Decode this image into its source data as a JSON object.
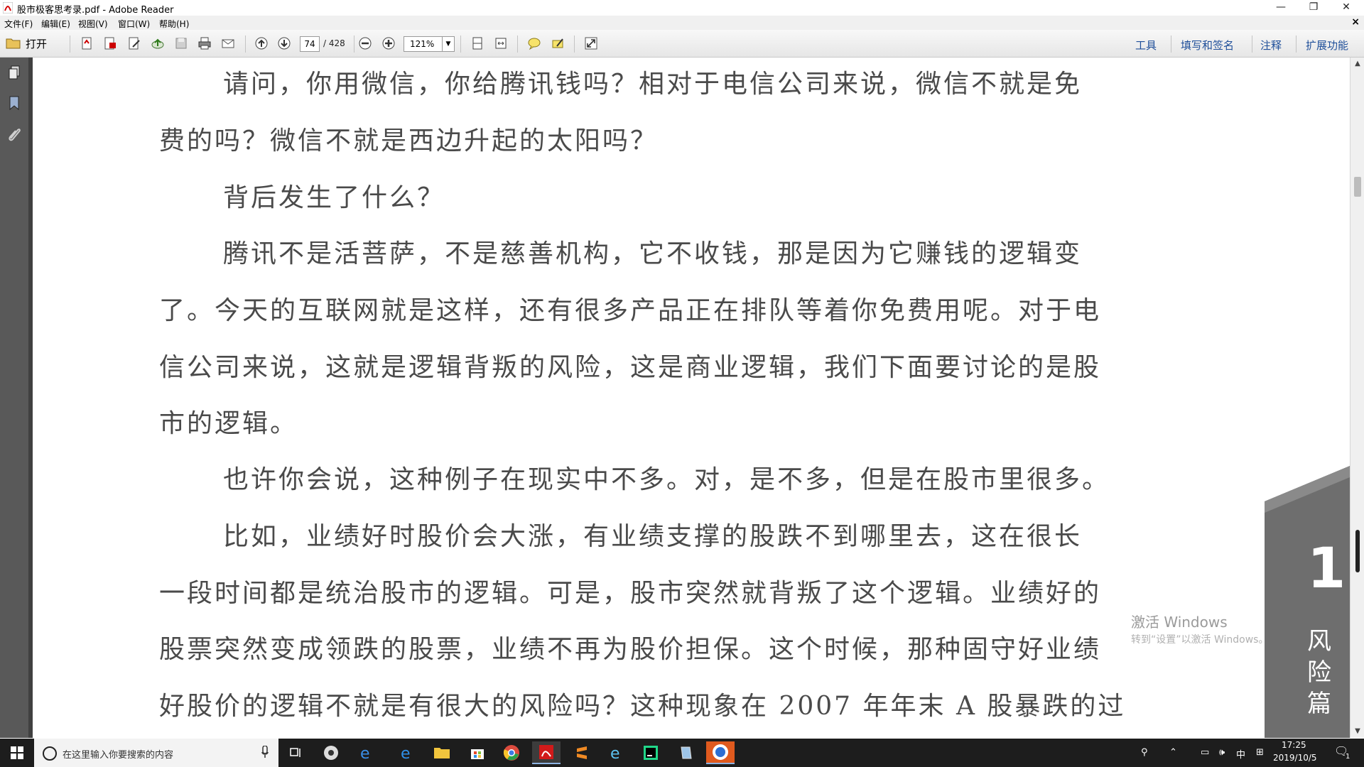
{
  "window": {
    "title": "股市极客思考录.pdf - Adobe Reader",
    "minimize": "—",
    "maximize": "❐",
    "close": "✕"
  },
  "menu": {
    "items": [
      "文件(F)",
      "编辑(E)",
      "视图(V)",
      "窗口(W)",
      "帮助(H)"
    ],
    "close_doc": "×"
  },
  "toolbar": {
    "open_label": "打开",
    "page_current": "74",
    "page_total": "/ 428",
    "zoom": "121%",
    "right_links": [
      "工具",
      "填写和签名",
      "注释",
      "扩展功能"
    ]
  },
  "document": {
    "lines": [
      "请问，你用微信，你给腾讯钱吗？相对于电信公司来说，微信不就是免",
      "费的吗？微信不就是西边升起的太阳吗？",
      "背后发生了什么？",
      "腾讯不是活菩萨，不是慈善机构，它不收钱，那是因为它赚钱的逻辑变",
      "了。今天的互联网就是这样，还有很多产品正在排队等着你免费用呢。对于电",
      "信公司来说，这就是逻辑背叛的风险，这是商业逻辑，我们下面要讨论的是股",
      "市的逻辑。",
      "也许你会说，这种例子在现实中不多。对，是不多，但是在股市里很多。",
      "比如，业绩好时股价会大涨，有业绩支撑的股跌不到哪里去，这在很长",
      "一段时间都是统治股市的逻辑。可是，股市突然就背叛了这个逻辑。业绩好的",
      "股票突然变成领跌的股票，业绩不再为股价担保。这个时候，那种固守好业绩",
      "好股价的逻辑不就是有很大的风险吗？这种现象在 2007 年年末 A 股暴跌的过"
    ],
    "side_tab_number": "1",
    "side_tab_text": "风险篇"
  },
  "watermark": {
    "line1": "激活 Windows",
    "line2": "转到“设置”以激活 Windows。"
  },
  "taskbar": {
    "search_placeholder": "在这里输入你要搜索的内容",
    "ime": "中",
    "time": "17:25",
    "date": "2019/10/5",
    "notification_count": "1"
  }
}
